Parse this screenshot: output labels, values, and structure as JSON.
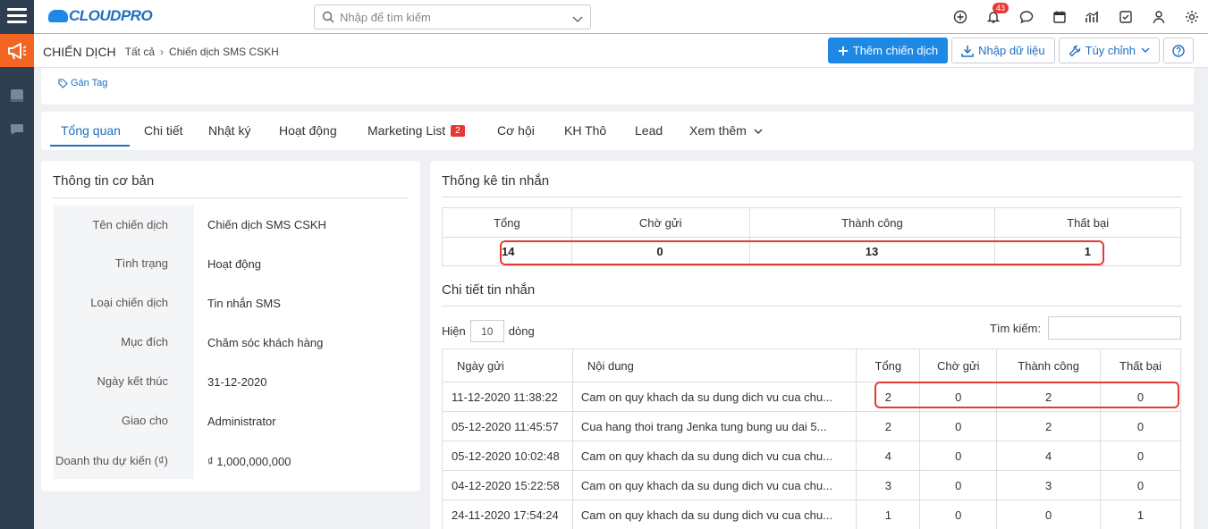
{
  "app": {
    "logo_text": "CLOUDPRO"
  },
  "search": {
    "placeholder": "Nhập để tìm kiếm"
  },
  "notifications": {
    "count": "43"
  },
  "breadcrumb": {
    "module": "CHIẾN DỊCH",
    "level1": "Tất cả",
    "level2": "Chiến dịch SMS CSKH"
  },
  "actions": {
    "add": "Thêm chiến dịch",
    "import": "Nhập dữ liệu",
    "customize": "Tùy chỉnh"
  },
  "tag": {
    "label": "Gán Tag"
  },
  "tabs": [
    {
      "label": "Tổng quan"
    },
    {
      "label": "Chi tiết"
    },
    {
      "label": "Nhật ký"
    },
    {
      "label": "Hoạt động"
    },
    {
      "label": "Marketing List",
      "badge": "2"
    },
    {
      "label": "Cơ hội"
    },
    {
      "label": "KH Thô"
    },
    {
      "label": "Lead"
    },
    {
      "label": "Xem thêm"
    }
  ],
  "basic_info": {
    "title": "Thông tin cơ bản",
    "rows": [
      {
        "label": "Tên chiến dịch",
        "value": "Chiến dịch SMS CSKH"
      },
      {
        "label": "Tình trạng",
        "value": "Hoạt động"
      },
      {
        "label": "Loại chiến dịch",
        "value": "Tin nhắn SMS"
      },
      {
        "label": "Mục đích",
        "value": "Chăm sóc khách hàng"
      },
      {
        "label": "Ngày kết thúc",
        "value": "31-12-2020"
      },
      {
        "label": "Giao cho",
        "value": "Administrator"
      },
      {
        "label": "Doanh thu dự kiến (₫)",
        "value": "₫ 1,000,000,000"
      }
    ]
  },
  "stats": {
    "title": "Thống kê tin nhắn",
    "headers": [
      "Tổng",
      "Chờ gửi",
      "Thành công",
      "Thất bại"
    ],
    "values": [
      "14",
      "0",
      "13",
      "1"
    ]
  },
  "detail": {
    "title": "Chi tiết tin nhắn",
    "show_prefix": "Hiện",
    "show_count": "10",
    "show_suffix": "dòng",
    "search_label": "Tìm kiếm:",
    "headers": [
      "Ngày gửi",
      "Nội dung",
      "Tổng",
      "Chờ gửi",
      "Thành công",
      "Thất bại"
    ],
    "rows": [
      [
        "11-12-2020 11:38:22",
        "Cam on quy khach da su dung dich vu cua chu...",
        "2",
        "0",
        "2",
        "0"
      ],
      [
        "05-12-2020 11:45:57",
        "Cua hang thoi trang Jenka tung bung uu dai 5...",
        "2",
        "0",
        "2",
        "0"
      ],
      [
        "05-12-2020 10:02:48",
        "Cam on quy khach da su dung dich vu cua chu...",
        "4",
        "0",
        "4",
        "0"
      ],
      [
        "04-12-2020 15:22:58",
        "Cam on quy khach da su dung dich vu cua chu...",
        "3",
        "0",
        "3",
        "0"
      ],
      [
        "24-11-2020 17:54:24",
        "Cam on quy khach da su dung dich vu cua chu...",
        "1",
        "0",
        "0",
        "1"
      ]
    ]
  }
}
